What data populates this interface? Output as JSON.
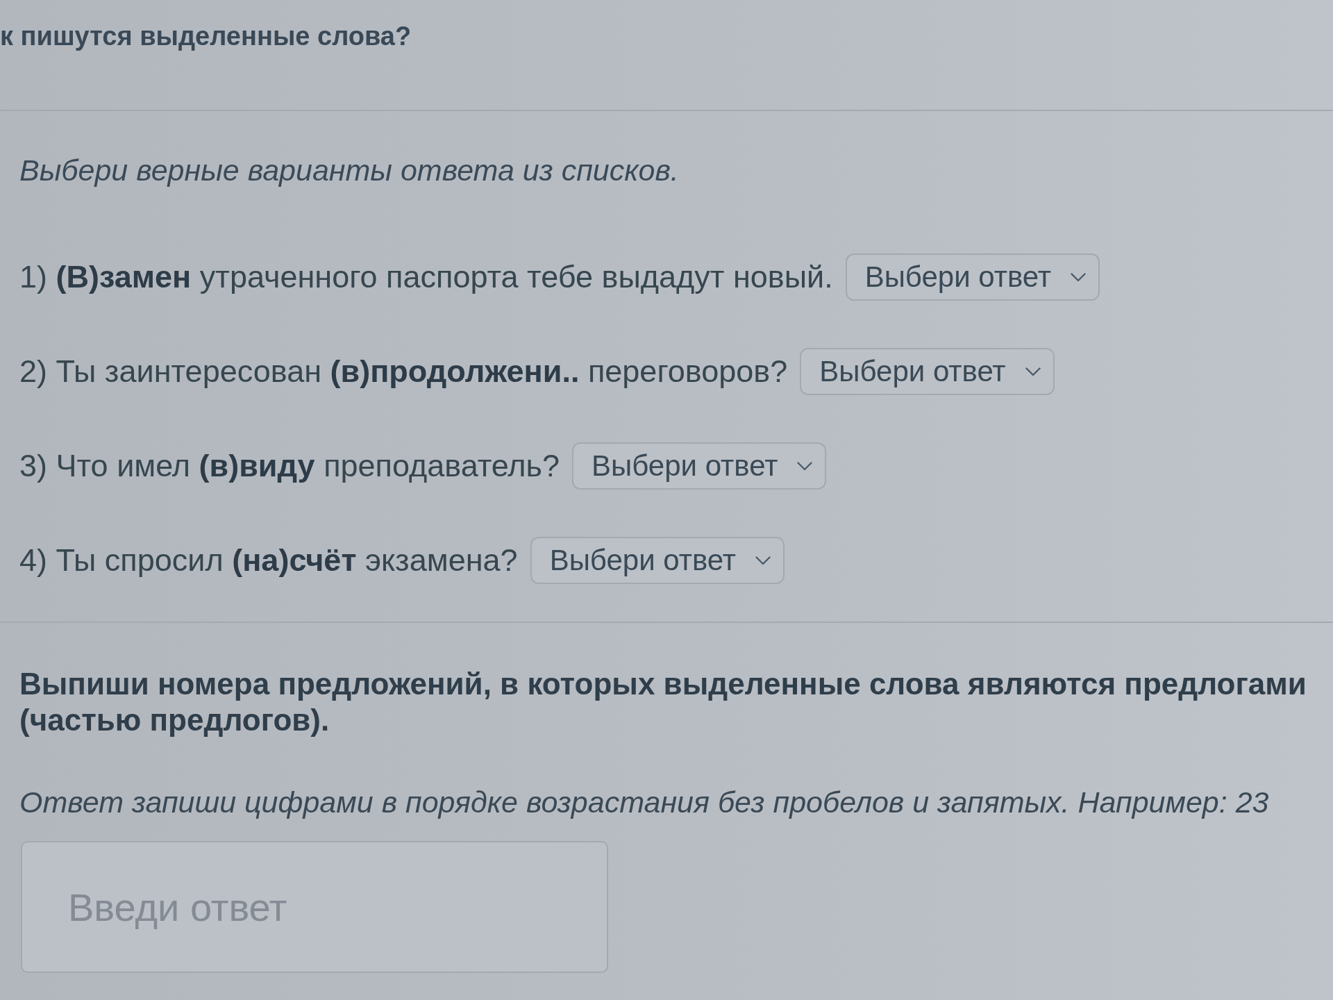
{
  "header": {
    "title": "к пишутся выделенные слова?"
  },
  "task_1": {
    "instruction": "Выбери верные варианты ответа из списков.",
    "sentences": [
      {
        "text": "1) **(В)замен** утраченного паспорта тебе выдадут новый.",
        "dropdown": {
          "placeholder": "Выбери ответ"
        }
      },
      {
        "text": "2) Ты заинтересован **(в)продолжени..** переговоров?",
        "dropdown": {
          "placeholder": "Выбери ответ"
        }
      },
      {
        "text": "3) Что имел **(в)виду** преподаватель?",
        "dropdown": {
          "placeholder": "Выбери ответ"
        }
      },
      {
        "text": "4) Ты спросил **(на)счёт** экзамена?",
        "dropdown": {
          "placeholder": "Выбери ответ"
        }
      }
    ]
  },
  "task_2": {
    "prompt": "Выпиши номера предложений, в которых выделенные слова являются предлогами (частью предлогов).",
    "note": "Ответ запиши цифрами в порядке возрастания без пробелов и запятых. Например: 23",
    "answer_field": {
      "placeholder": "Введи ответ"
    }
  }
}
